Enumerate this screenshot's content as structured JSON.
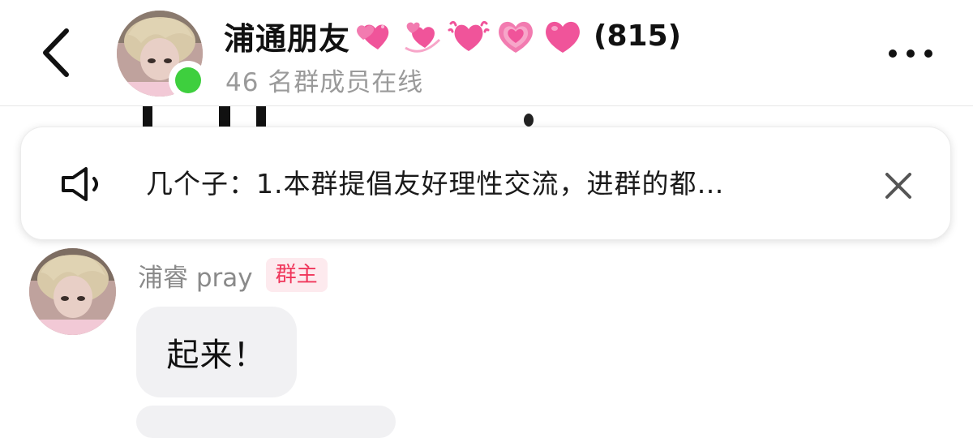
{
  "header": {
    "group_name": "浦通朋友",
    "member_count": "(815)",
    "online_status": "46 名群成员在线",
    "heart_emojis": [
      "heart-with-ribbon-icon",
      "revolving-hearts-icon",
      "beating-heart-icon",
      "growing-heart-icon",
      "pink-heart-icon"
    ],
    "online_indicator_color": "#3ecf3e"
  },
  "announcement": {
    "text": "几个子：1.本群提倡友好理性交流，进群的都…"
  },
  "messages": [
    {
      "sender": "浦睿 pray",
      "role_badge": "群主",
      "text": "起来！"
    }
  ],
  "colors": {
    "badge_text": "#f0365b",
    "badge_bg": "#fdeaee",
    "bubble_bg": "#f1f1f3",
    "heart_pink": "#f0549a"
  }
}
